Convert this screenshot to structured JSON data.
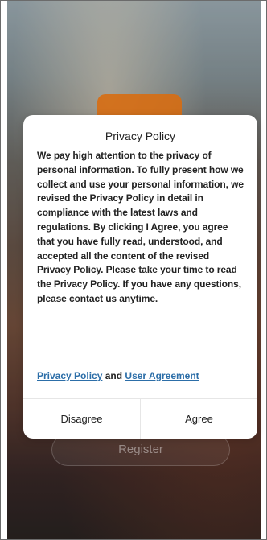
{
  "background": {
    "register_label": "Register"
  },
  "dialog": {
    "title": "Privacy Policy",
    "body": "We pay high attention to the privacy of personal information. To fully present how we collect and use your personal information, we revised the Privacy Policy in detail in compliance with the latest laws and regulations. By clicking I Agree, you agree that you have fully read, understood, and accepted all the content of the revised Privacy Policy. Please take your time to read the Privacy Policy. If you have any questions, please contact us anytime.",
    "privacy_policy_link": "Privacy Policy",
    "links_connector": " and ",
    "user_agreement_link": "User Agreement",
    "disagree_label": "Disagree",
    "agree_label": "Agree"
  },
  "colors": {
    "link": "#2c6ea8",
    "accent_orange": "#d76d12",
    "dialog_background": "#ffffff"
  }
}
